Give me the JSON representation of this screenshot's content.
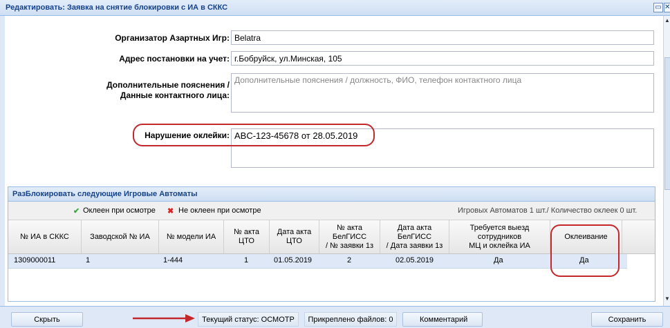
{
  "window": {
    "title": "Редактировать: Заявка на снятие блокировки с ИА в СККС",
    "restore_icon": "restore-icon",
    "close_icon": "close-icon"
  },
  "form": {
    "organizer_label": "Организатор Азартных Игр:",
    "organizer_value": "Belatra",
    "address_label": "Адрес постановки на учет:",
    "address_value": "г.Бобруйск, ул.Минская, 105",
    "notes_label_1": "Дополнительные пояснения /",
    "notes_label_2": "Данные контактного лица:",
    "notes_placeholder": "Дополнительные пояснения / должность, ФИО, телефон контактного лица",
    "violation_label": "Нарушение оклейки:",
    "violation_value": "ABC-123-45678 от 28.05.2019"
  },
  "panel": {
    "title": "РазБлокировать следующие Игровые Автоматы",
    "legend_ok": "Оклеен при осмотре",
    "legend_not_ok": "Не оклеен при осмотре",
    "summary": "Игровых Автоматов 1 шт./ Количество оклеек 0 шт.",
    "columns": [
      {
        "l1": "№ ИА в СККС",
        "l2": "",
        "l3": ""
      },
      {
        "l1": "Заводской № ИА",
        "l2": "",
        "l3": ""
      },
      {
        "l1": "№ модели ИА",
        "l2": "",
        "l3": ""
      },
      {
        "l1": "№ акта",
        "l2": "ЦТО",
        "l3": ""
      },
      {
        "l1": "Дата акта",
        "l2": "ЦТО",
        "l3": ""
      },
      {
        "l1": "№ акта",
        "l2": "БелГИСС",
        "l3": "/ № заявки 1з"
      },
      {
        "l1": "Дата акта",
        "l2": "БелГИСС",
        "l3": "/ Дата заявки 1з"
      },
      {
        "l1": "Требуется выезд",
        "l2": "сотрудников",
        "l3": "МЦ и оклейка ИА"
      },
      {
        "l1": "Оклеивание",
        "l2": "",
        "l3": ""
      }
    ],
    "rows": [
      [
        "1309000011",
        "1",
        "1-444",
        "1",
        "01.05.2019",
        "2",
        "02.05.2019",
        "Да",
        "Да"
      ]
    ]
  },
  "footer": {
    "hide_button": "Скрыть",
    "status": "Текущий статус: ОСМОТР",
    "files": "Прикреплено файлов: 0",
    "comment_button": "Комментарий",
    "save_button": "Сохранить"
  },
  "colors": {
    "highlight_oval": "#c3272b",
    "header_text": "#15428b",
    "row_selected": "#dfe8f6"
  }
}
